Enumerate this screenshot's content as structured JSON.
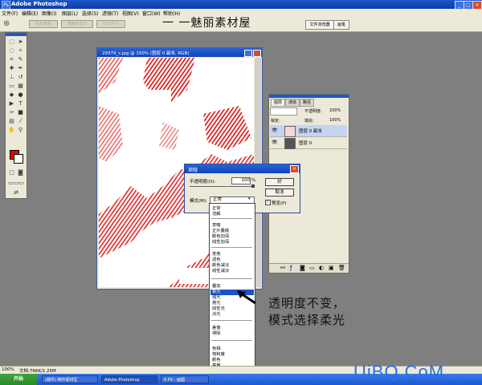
{
  "window": {
    "title": "Adobe Photoshop",
    "controls": [
      "_",
      "□",
      "×"
    ]
  },
  "menu": [
    "文件(F)",
    "编辑(E)",
    "图像(I)",
    "图层(L)",
    "选择(S)",
    "滤镜(T)",
    "视图(V)",
    "窗口(W)",
    "帮助(H)"
  ],
  "options": {
    "buttons": [
      "实际像素",
      "满画布显示",
      "打印尺寸"
    ],
    "tabs": [
      "文件浏览器",
      "画笔"
    ]
  },
  "watermark": "一 一魅丽素材屋",
  "document": {
    "title": "29379_s.jpg @ 100% (图层 0 副本, RGB)"
  },
  "layers_panel": {
    "tabs": [
      "图层",
      "通道",
      "路径"
    ],
    "opacity_label": "不透明度:",
    "opacity_value": "100%",
    "lock_label": "锁定:",
    "fill_label": "填充:",
    "fill_value": "100%",
    "layers": [
      {
        "name": "图层 0 副本",
        "selected": true
      },
      {
        "name": "图层 0",
        "selected": false
      }
    ]
  },
  "fade_dialog": {
    "title": "渐隐",
    "opacity_label": "不透明度(O):",
    "opacity_value": "100",
    "opacity_unit": "%",
    "ok": "好",
    "cancel": "取消",
    "preview": "预览(P)",
    "mode_label": "模式(M):",
    "mode_value": "正常"
  },
  "blend_modes": [
    [
      "正常",
      "溶解"
    ],
    [
      "变暗",
      "正片叠底",
      "颜色加深",
      "线性加深"
    ],
    [
      "变亮",
      "滤色",
      "颜色减淡",
      "线性减淡"
    ],
    [
      "叠加",
      "柔光",
      "强光",
      "亮光",
      "线性光",
      "点光"
    ],
    [
      "差值",
      "排除"
    ],
    [
      "色相",
      "饱和度",
      "颜色",
      "亮度"
    ]
  ],
  "highlighted_mode": "柔光",
  "annotation": {
    "line1": "透明度不变，",
    "line2": "模式选择柔光"
  },
  "status": {
    "zoom": "100%",
    "doc": "文档:766K/1.25M"
  },
  "taskbar": {
    "start": "开始",
    "tasks": [
      "(邮件) 制作素材区",
      "Adobe Photoshop",
      "6 PS - 画图"
    ],
    "clock": ""
  },
  "site_watermark": "UiBQ.CoM",
  "colors": {
    "foreground": "#e60000",
    "background": "#ffffff",
    "accent": "#1f56c9"
  }
}
